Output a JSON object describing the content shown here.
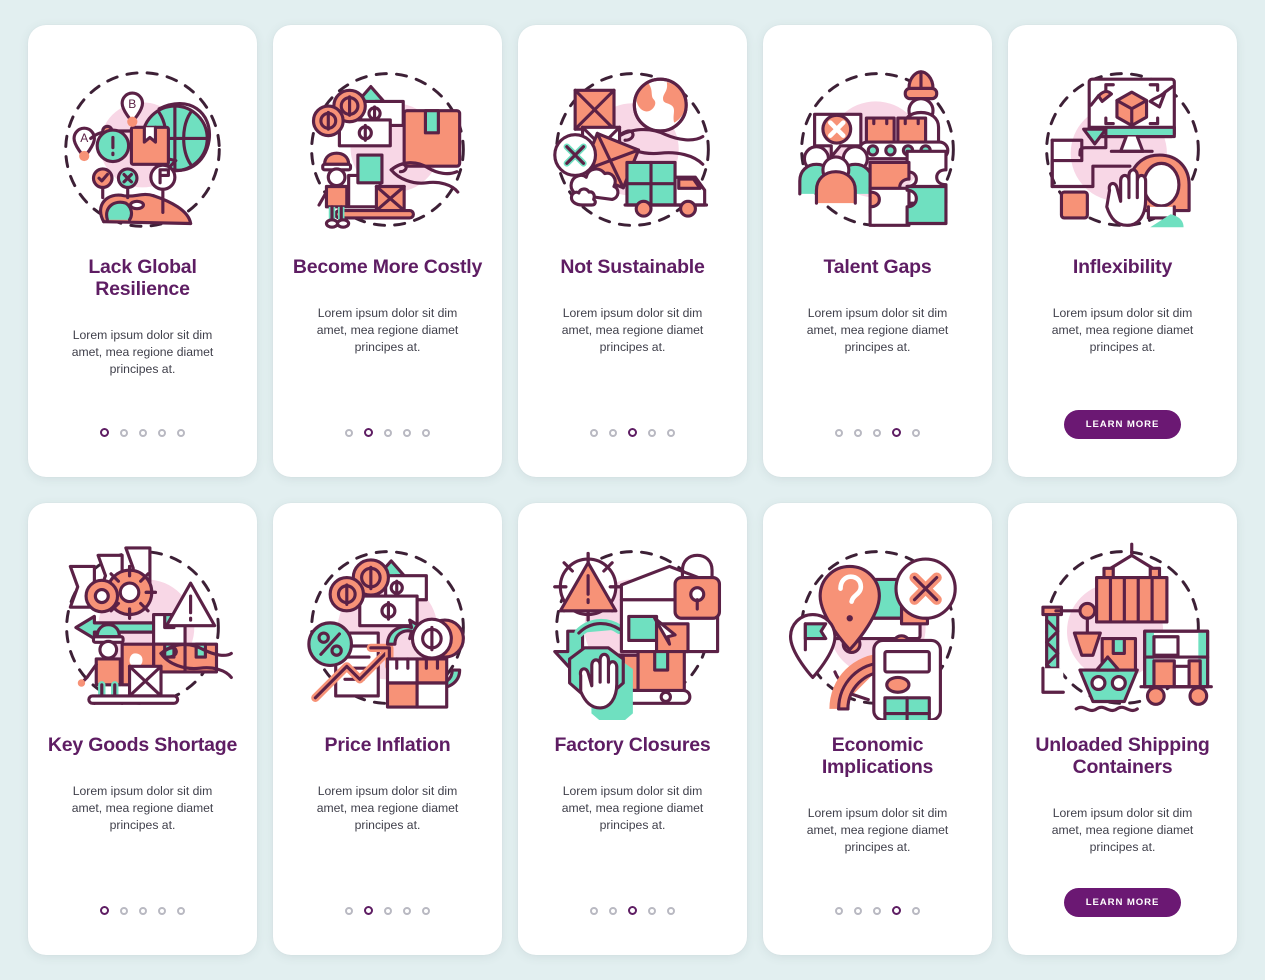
{
  "page": {
    "background_color": "#e2eff0",
    "title_color": "#5e1d63",
    "accent_color": "#6b1873",
    "palette": {
      "orange": "#f79277",
      "mint": "#6fe0c0",
      "pink_blob": "#f8d7e6",
      "outline": "#5b2146",
      "dot_inactive": "#b9b9c2"
    }
  },
  "shared": {
    "body_text": "Lorem ipsum dolor sit dim amet, mea regione diamet principes at.",
    "learn_more_label": "LEARN MORE",
    "dot_count": 5
  },
  "cards": [
    {
      "title": "Lack Global Resilience",
      "body": "Lorem ipsum dolor sit dim amet, mea regione diamet principes at.",
      "icon": "global-resilience-icon",
      "active_dot": 1,
      "has_button": false,
      "row": 1,
      "column": 1
    },
    {
      "title": "Become More Costly",
      "body": "Lorem ipsum dolor sit dim amet, mea regione diamet principes at.",
      "icon": "rising-cost-icon",
      "active_dot": 2,
      "has_button": false,
      "row": 1,
      "column": 2
    },
    {
      "title": "Not Sustainable",
      "body": "Lorem ipsum dolor sit dim amet, mea regione diamet principes at.",
      "icon": "unsustainable-delivery-icon",
      "active_dot": 3,
      "has_button": false,
      "row": 1,
      "column": 3
    },
    {
      "title": "Talent Gaps",
      "body": "Lorem ipsum dolor sit dim amet, mea regione diamet principes at.",
      "icon": "talent-gap-icon",
      "active_dot": 4,
      "has_button": false,
      "row": 1,
      "column": 4
    },
    {
      "title": "Inflexibility",
      "body": "Lorem ipsum dolor sit dim amet, mea regione diamet principes at.",
      "icon": "inflexibility-icon",
      "active_dot": 0,
      "has_button": true,
      "button_label": "LEARN MORE",
      "row": 1,
      "column": 5
    },
    {
      "title": "Key Goods Shortage",
      "body": "Lorem ipsum dolor sit dim amet, mea regione diamet principes at.",
      "icon": "goods-shortage-icon",
      "active_dot": 1,
      "has_button": false,
      "row": 2,
      "column": 1
    },
    {
      "title": "Price Inflation",
      "body": "Lorem ipsum dolor sit dim amet, mea regione diamet principes at.",
      "icon": "price-inflation-icon",
      "active_dot": 2,
      "has_button": false,
      "row": 2,
      "column": 2
    },
    {
      "title": "Factory Closures",
      "body": "Lorem ipsum dolor sit dim amet, mea regione diamet principes at.",
      "icon": "factory-closure-icon",
      "active_dot": 3,
      "has_button": false,
      "row": 2,
      "column": 3
    },
    {
      "title": "Economic Implications",
      "body": "Lorem ipsum dolor sit dim amet, mea regione diamet principes at.",
      "icon": "economic-implications-icon",
      "active_dot": 4,
      "has_button": false,
      "row": 2,
      "column": 4
    },
    {
      "title": "Unloaded Shipping Containers",
      "body": "Lorem ipsum dolor sit dim amet, mea regione diamet principes at.",
      "icon": "shipping-container-icon",
      "active_dot": 0,
      "has_button": true,
      "button_label": "LEARN MORE",
      "row": 2,
      "column": 5
    }
  ]
}
